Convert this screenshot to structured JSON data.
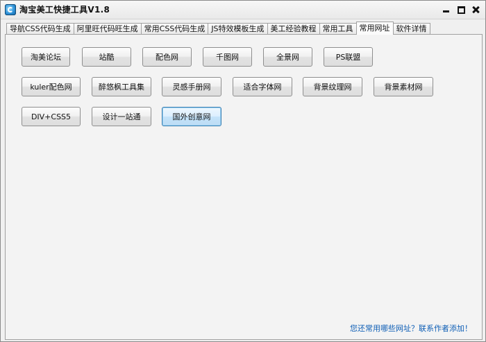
{
  "window": {
    "title": "淘宝美工快捷工具V1.8"
  },
  "tabs": [
    {
      "label": "导航CSS代码生成",
      "active": false
    },
    {
      "label": "阿里旺代码旺生成",
      "active": false
    },
    {
      "label": "常用CSS代码生成",
      "active": false
    },
    {
      "label": "JS特效模板生成",
      "active": false
    },
    {
      "label": "美工经验教程",
      "active": false
    },
    {
      "label": "常用工具",
      "active": false
    },
    {
      "label": "常用网址",
      "active": true
    },
    {
      "label": "软件详情",
      "active": false
    }
  ],
  "buttons": {
    "row1": [
      "淘美论坛",
      "站酷",
      "配色网",
      "千图网",
      "全景网",
      "PS联盟"
    ],
    "row2": [
      "kuler配色网",
      "醉悠枫工具集",
      "灵感手册网",
      "适合字体网",
      "背景纹理网",
      "背景素材网"
    ],
    "row3": [
      "DIV+CSS5",
      "设计一站通",
      "国外创意网"
    ]
  },
  "focused_button": "国外创意网",
  "footer": {
    "link_text": "您还常用哪些网址？联系作者添加！"
  }
}
